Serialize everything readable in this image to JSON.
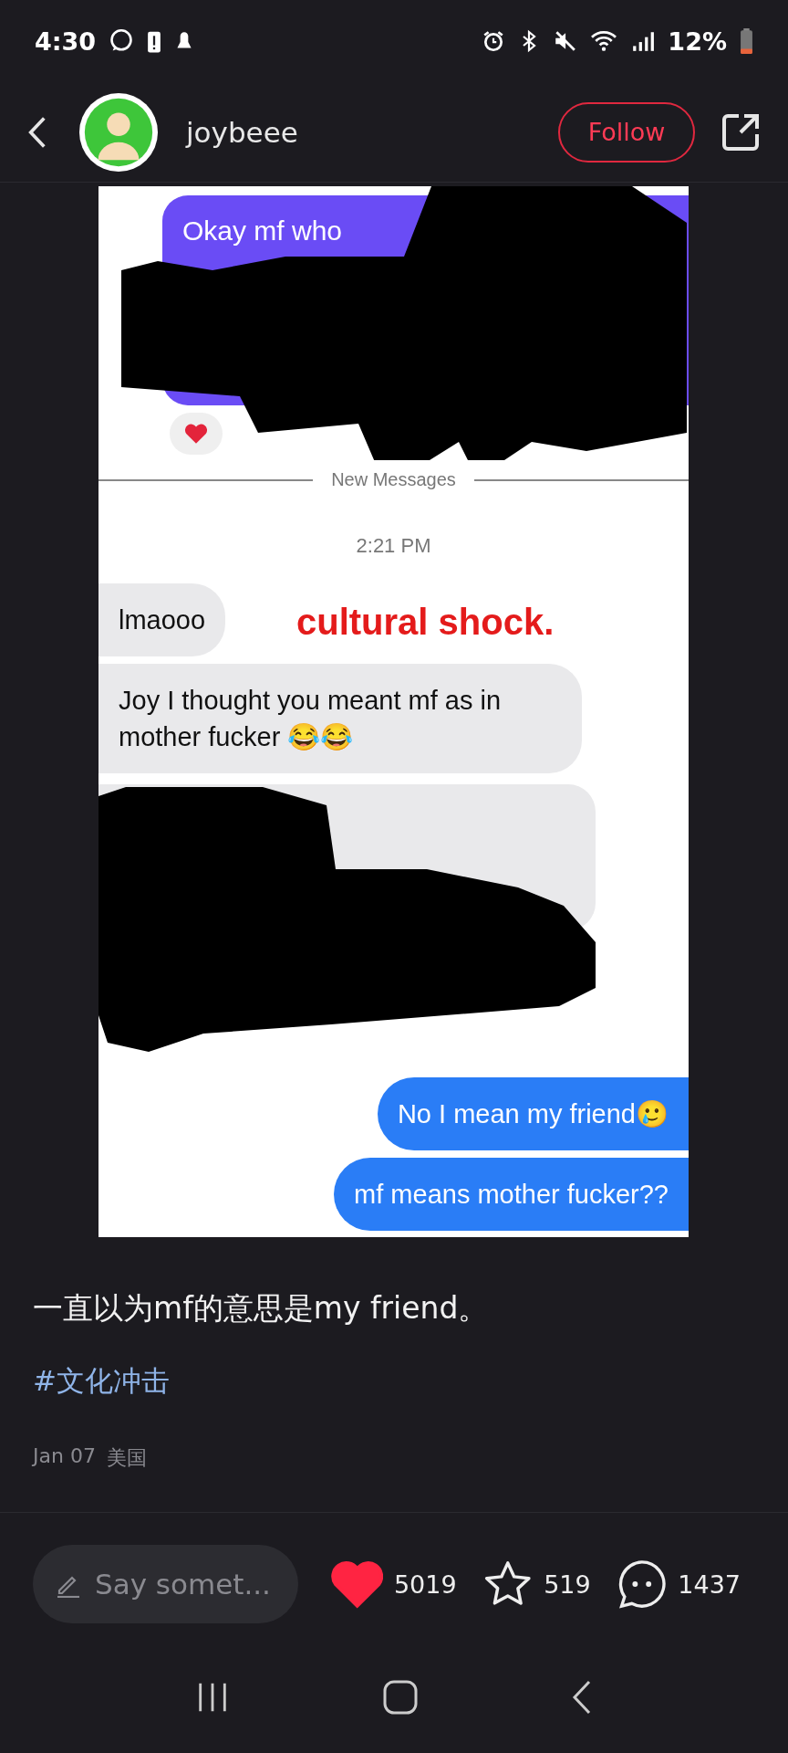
{
  "status_bar": {
    "time": "4:30",
    "battery": "12%"
  },
  "header": {
    "username": "joybeee",
    "follow_button": "Follow"
  },
  "chat": {
    "top_message": "Okay mf who",
    "divider_label": "New Messages",
    "timestamp": "2:21 PM",
    "overlay_text": "cultural shock.",
    "received": [
      {
        "text": "lmaooo"
      },
      {
        "text": "Joy I thought you meant mf as in mother fucker 😂😂"
      }
    ],
    "sent": [
      {
        "text": "No I mean my friend🥲"
      },
      {
        "text": "mf means mother fucker??"
      }
    ]
  },
  "caption": "一直以为mf的意思是my friend。",
  "hashtag": "#文化冲击",
  "date": "Jan 07",
  "location": "美国",
  "actions": {
    "comment_placeholder": "Say somet...",
    "likes": "5019",
    "liked": true,
    "stars": "519",
    "starred": false,
    "comments": "1437"
  }
}
